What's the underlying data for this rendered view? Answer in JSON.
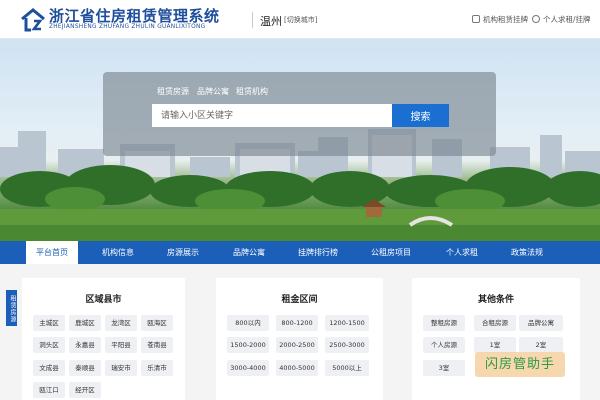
{
  "header": {
    "title": "浙江省住房租赁管理系统",
    "subtitle": "ZHEJIANSHENG ZHUFANG ZHULIN GUANLIXITONG",
    "city": "温州",
    "switch_city": "[切换城市]",
    "links": [
      {
        "label": "机构租赁挂牌",
        "icon": "building-icon"
      },
      {
        "label": "个人求租/挂牌",
        "icon": "person-icon"
      }
    ]
  },
  "search": {
    "tabs": [
      "租赁房源",
      "品牌公寓",
      "租赁机构"
    ],
    "placeholder": "请输入小区关键字",
    "button": "搜索"
  },
  "nav": {
    "items": [
      "平台首页",
      "机构信息",
      "房源展示",
      "品牌公寓",
      "挂牌排行榜",
      "公租房项目",
      "个人求租",
      "政策法规"
    ],
    "active_index": 0
  },
  "side_tag": "租赁房源",
  "cards": [
    {
      "title": "区域县市",
      "tags": [
        "主城区",
        "鹿城区",
        "龙湾区",
        "瓯海区",
        "洞头区",
        "永嘉县",
        "平阳县",
        "苍南县",
        "文成县",
        "泰顺县",
        "瑞安市",
        "乐清市",
        "瓯江口",
        "经开区"
      ]
    },
    {
      "title": "租金区间",
      "tags": [
        "800以内",
        "800-1200",
        "1200-1500",
        "1500-2000",
        "2000-2500",
        "2500-3000",
        "3000-4000",
        "4000-5000",
        "5000以上"
      ]
    },
    {
      "title": "其他条件",
      "tags": [
        "整租房源",
        "合租房源",
        "品牌公寓",
        "个人房源",
        "1室",
        "2室",
        "3室"
      ]
    }
  ],
  "watermark": "闪房管助手",
  "colors": {
    "brand": "#1f4f9c",
    "nav": "#1c5fb8",
    "button": "#1a6fd1"
  }
}
